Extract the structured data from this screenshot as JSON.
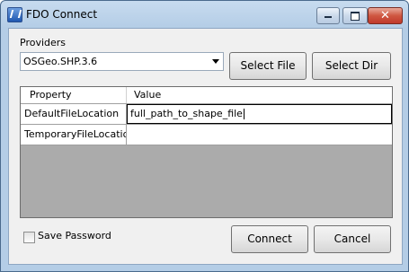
{
  "window": {
    "title": "FDO Connect",
    "close_glyph": "✕"
  },
  "providers": {
    "label": "Providers",
    "selected": "OSGeo.SHP.3.6"
  },
  "buttons": {
    "select_file": "Select File",
    "select_dir": "Select Dir",
    "connect": "Connect",
    "cancel": "Cancel"
  },
  "grid": {
    "columns": [
      "Property",
      "Value"
    ],
    "rows": [
      {
        "property": "DefaultFileLocation",
        "value": "full_path_to_shape_file"
      },
      {
        "property": "TemporaryFileLocation",
        "value": ""
      }
    ]
  },
  "save_password": {
    "label": "Save Password",
    "checked": false
  },
  "icons": {
    "app": "fdo-connect-app-icon",
    "minimize": "minimize-icon",
    "maximize": "maximize-icon",
    "close": "close-icon",
    "dropdown": "chevron-down-icon"
  }
}
